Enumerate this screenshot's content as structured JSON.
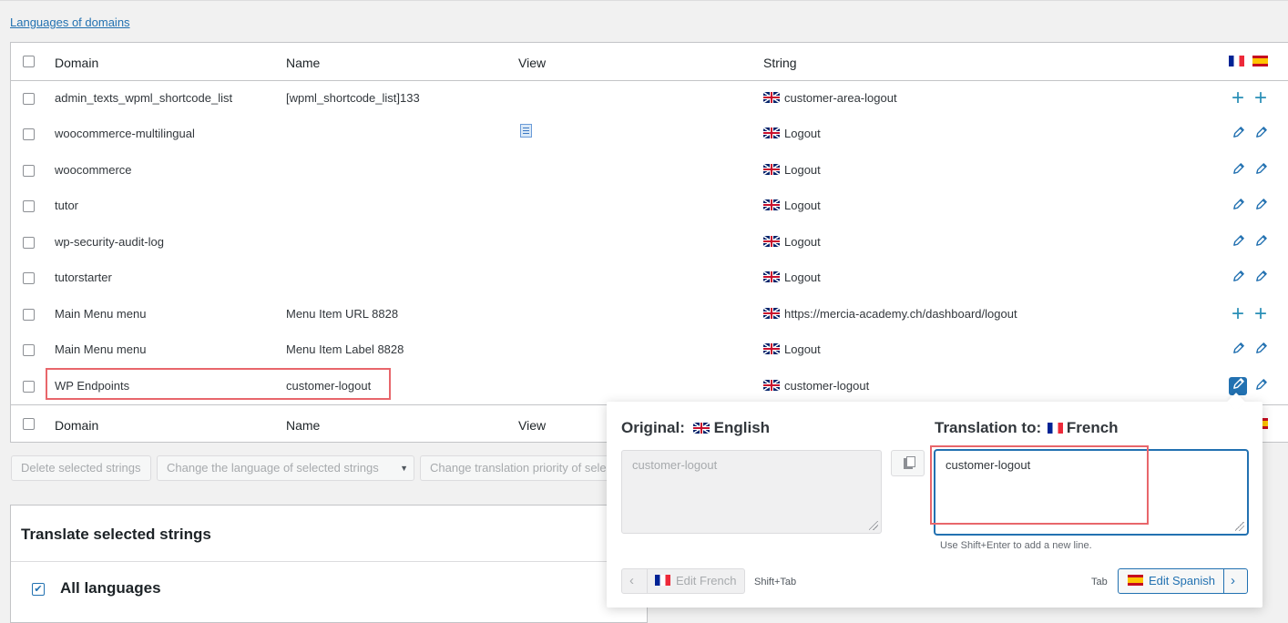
{
  "top_link": "Languages of domains",
  "table": {
    "headers": {
      "domain": "Domain",
      "name": "Name",
      "view": "View",
      "string": "String"
    },
    "rows": [
      {
        "domain": "admin_texts_wpml_shortcode_list",
        "name": "[wpml_shortcode_list]133",
        "string": "customer-area-logout",
        "fr_action": "add",
        "es_action": "add",
        "has_view": false
      },
      {
        "domain": "woocommerce-multilingual",
        "name": "",
        "string": "Logout",
        "fr_action": "edit",
        "es_action": "edit",
        "has_view": true
      },
      {
        "domain": "woocommerce",
        "name": "",
        "string": "Logout",
        "fr_action": "edit",
        "es_action": "edit",
        "has_view": false
      },
      {
        "domain": "tutor",
        "name": "",
        "string": "Logout",
        "fr_action": "edit",
        "es_action": "edit",
        "has_view": false
      },
      {
        "domain": "wp-security-audit-log",
        "name": "",
        "string": "Logout",
        "fr_action": "edit",
        "es_action": "edit",
        "has_view": false
      },
      {
        "domain": "tutorstarter",
        "name": "",
        "string": "Logout",
        "fr_action": "edit",
        "es_action": "edit",
        "has_view": false
      },
      {
        "domain": "Main Menu menu",
        "name": "Menu Item URL 8828",
        "string": "https://mercia-academy.ch/dashboard/logout",
        "fr_action": "add",
        "es_action": "add",
        "has_view": false
      },
      {
        "domain": "Main Menu menu",
        "name": "Menu Item Label 8828",
        "string": "Logout",
        "fr_action": "edit",
        "es_action": "edit",
        "has_view": false
      },
      {
        "domain": "WP Endpoints",
        "name": "customer-logout",
        "string": "customer-logout",
        "fr_action": "edit-active",
        "es_action": "edit",
        "has_view": false
      }
    ]
  },
  "bulk_actions": {
    "delete": "Delete selected strings",
    "change_language": "Change the language of selected strings",
    "change_priority": "Change translation priority of sele"
  },
  "translate_panel": {
    "title": "Translate selected strings",
    "all_languages": "All languages"
  },
  "popup": {
    "original_label": "Original:",
    "original_lang": "English",
    "translation_label": "Translation to:",
    "translation_lang": "French",
    "original_value": "customer-logout",
    "translation_value": "customer-logout",
    "hint": "Use Shift+Enter to add a new line.",
    "edit_prev": "Edit French",
    "prev_key": "Shift+Tab",
    "next_key": "Tab",
    "edit_next": "Edit Spanish"
  },
  "colors": {
    "accent": "#2271b1",
    "highlight": "#e8666b"
  }
}
